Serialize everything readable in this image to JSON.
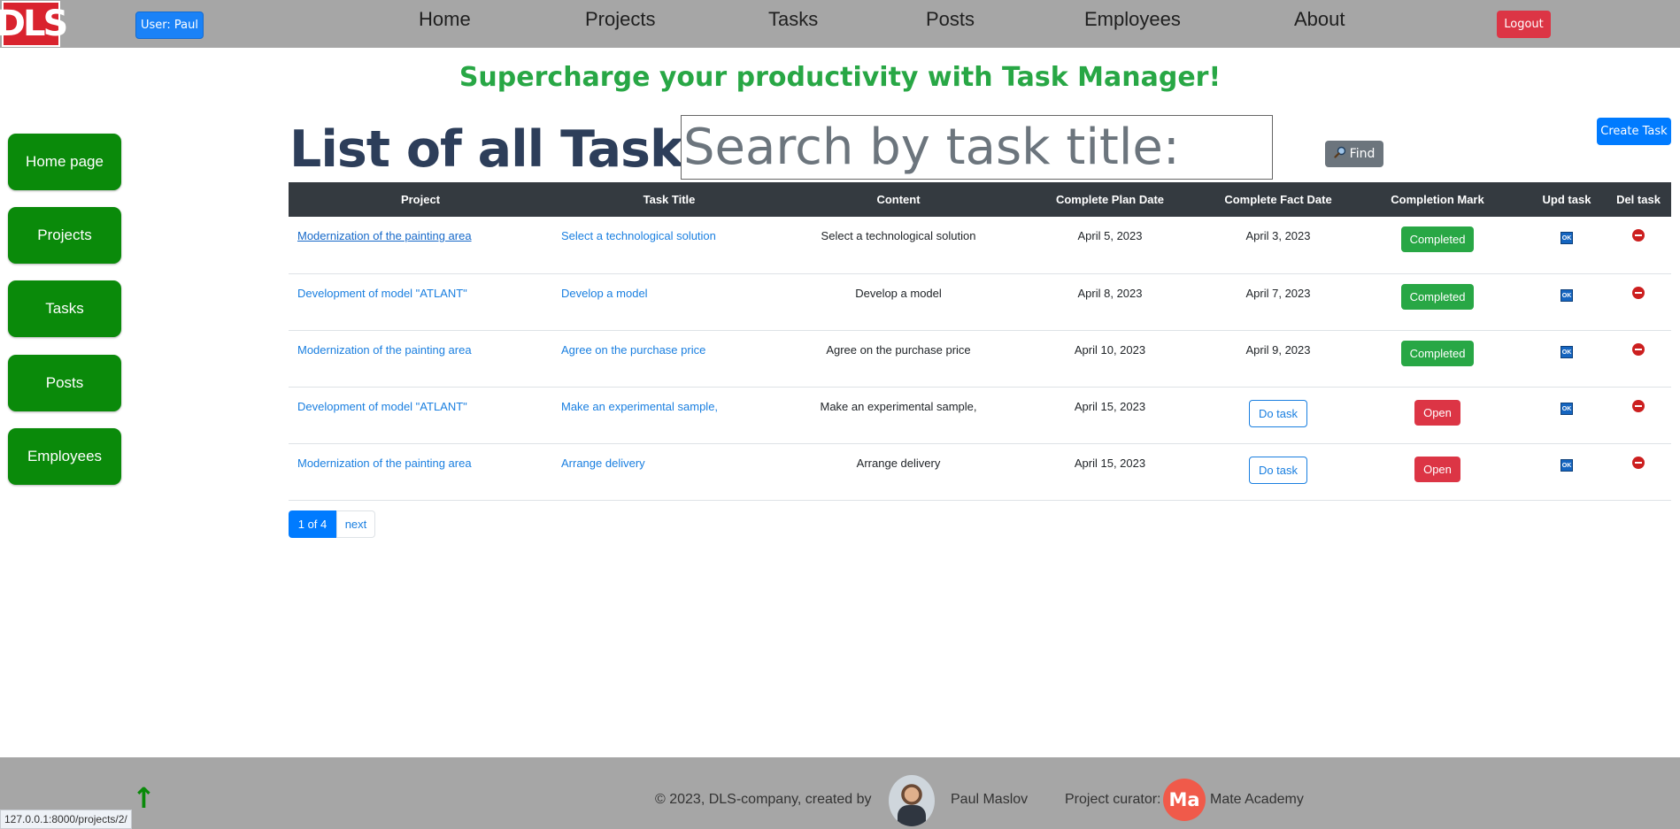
{
  "header": {
    "logo_text": "DLS",
    "user_label": "User: Paul",
    "nav": [
      "Home",
      "Projects",
      "Tasks",
      "Posts",
      "Employees",
      "About"
    ],
    "logout_label": "Logout"
  },
  "tagline": "Supercharge your productivity with Task Manager!",
  "sidebar": {
    "items": [
      "Home page",
      "Projects",
      "Tasks",
      "Posts",
      "Employees"
    ]
  },
  "main": {
    "heading": "List of all Tasks.",
    "search_placeholder": "Search by task title:",
    "find_label": "Find",
    "create_label": "Create Task",
    "columns": [
      "Project",
      "Task Title",
      "Content",
      "Complete Plan Date",
      "Complete Fact Date",
      "Completion Mark",
      "Upd task",
      "Del task"
    ],
    "rows": [
      {
        "project": "Modernization of the painting area",
        "title": "Select a technological solution",
        "content": "Select a technological solution",
        "plan_date": "April 5, 2023",
        "fact_date": "April 3, 2023",
        "mark": "Completed",
        "upd": "OK"
      },
      {
        "project": "Development of model \"ATLANT\"",
        "title": "Develop a model",
        "content": "Develop a model",
        "plan_date": "April 8, 2023",
        "fact_date": "April 7, 2023",
        "mark": "Completed",
        "upd": "OK"
      },
      {
        "project": "Modernization of the painting area",
        "title": "Agree on the purchase price",
        "content": "Agree on the purchase price",
        "plan_date": "April 10, 2023",
        "fact_date": "April 9, 2023",
        "mark": "Completed",
        "upd": "OK"
      },
      {
        "project": "Development of model \"ATLANT\"",
        "title": "Make an experimental sample,",
        "content": "Make an experimental sample,",
        "plan_date": "April 15, 2023",
        "fact_date": "Do task",
        "mark": "Open",
        "upd": "OK"
      },
      {
        "project": "Modernization of the painting area",
        "title": "Arrange delivery",
        "content": "Arrange delivery",
        "plan_date": "April 15, 2023",
        "fact_date": "Do task",
        "mark": "Open",
        "upd": "OK"
      }
    ],
    "pagination": {
      "current": "1 of 4",
      "next": "next"
    }
  },
  "footer": {
    "copyright": "© 2023, DLS-company, created by",
    "author": "Paul Maslov",
    "curator_label": "Project curator:",
    "curator_logo": "Ma",
    "curator_name": "Mate Academy",
    "up_arrow": "↑"
  },
  "status_url": "127.0.0.1:8000/projects/2/",
  "colors": {
    "header_bg": "#a6a6a6",
    "sidebar_btn": "#0a8a0a",
    "tagline": "#28a745",
    "heading": "#2d3e5a",
    "table_header": "#343a40",
    "completed": "#28a745",
    "open": "#dc3545",
    "link": "#1a7fe0"
  }
}
